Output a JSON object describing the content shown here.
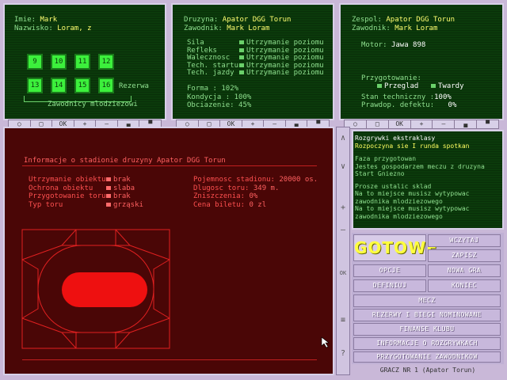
{
  "panel1": {
    "imie_label": "Imie:",
    "imie_value": "Mark",
    "nazwisko_label": "Nazwisko:",
    "nazwisko_value": "Loram, z",
    "squares_top": [
      "9",
      "10",
      "11",
      "12"
    ],
    "squares_bottom": [
      "13",
      "14",
      "15",
      "16"
    ],
    "rezerwa_label": "Rezerwa",
    "mlodziezowi_label": "Zawodnicy mlodziezowi"
  },
  "panel2": {
    "druzyna_label": "Druzyna:",
    "druzyna_value": "Apator DGG Torun",
    "zawodnik_label": "Zawodnik:",
    "zawodnik_value": "Mark Loram",
    "stats": [
      {
        "label": "Sila",
        "value": "Utrzymanie poziomu"
      },
      {
        "label": "Refleks",
        "value": "Utrzymanie poziomu"
      },
      {
        "label": "Walecznosc",
        "value": "Utrzymanie poziomu"
      },
      {
        "label": "Tech. startu",
        "value": "Utrzymanie poziomu"
      },
      {
        "label": "Tech. jazdy",
        "value": "Utrzymanie poziomu"
      }
    ],
    "forma_label": "Forma",
    "forma_value": ": 102%",
    "kondycja_label": "Kondycja",
    "kondycja_value": ": 100%",
    "obciazenie_label": "Obciazenie:",
    "obciazenie_value": "45%"
  },
  "panel3": {
    "zespol_label": "Zespol:",
    "zespol_value": "Apator DGG Torun",
    "zawodnik_label": "Zawodnik:",
    "zawodnik_value": "Mark Loram",
    "motor_label": "Motor:",
    "motor_value": "Jawa 898",
    "przygotowanie_label": "Przygotowanie:",
    "przeglad": "Przeglad",
    "twardy": "Twardy",
    "stan_label": "Stan techniczny :",
    "stan_value": "100%",
    "prawdop_label": "Prawdop. defektu:",
    "prawdop_value": "0%"
  },
  "toolbar_labels": [
    "○",
    "□",
    "OK",
    "+",
    "–",
    "▄",
    "▀"
  ],
  "stadium": {
    "title": "Informacje o stadionie druzyny Apator DGG Torun",
    "left_rows": [
      {
        "label": "Utrzymanie obiektu",
        "value": "brak"
      },
      {
        "label": "Ochrona obiektu",
        "value": "slaba"
      },
      {
        "label": "Przygotowanie toru",
        "value": "brak"
      },
      {
        "label": "Typ toru",
        "value": "grząski"
      }
    ],
    "right_rows": [
      {
        "label": "Pojemnosc stadionu:",
        "value": "20000 os."
      },
      {
        "label": "Dlugosc toru:",
        "value": "349 m."
      },
      {
        "label": "Zniszczenia:",
        "value": "0%"
      },
      {
        "label": "Cena biletu:",
        "value": "0 zl"
      }
    ]
  },
  "sidebar_icons": [
    "∧",
    "∨",
    "+",
    "–",
    "OK",
    "≡",
    "?"
  ],
  "messages": {
    "line1": "Rozgrywki ekstraklasy",
    "line2": "Rozpoczyna sie I runda spotkan",
    "line3": "Faza przygotowan",
    "line4": "Jestes gospodarzem meczu z druzyna",
    "line5": "Start Gniezno",
    "line6": "Prosze ustalic sklad",
    "line7": "Na to miejsce musisz wytypowac",
    "line8": "zawodnika mlodziezowego",
    "line9": "Na to miejsce musisz wytypowac",
    "line10": "zawodnika mlodziezowego"
  },
  "menu": {
    "gotowe": "GOTOWE",
    "wczytaj": "WCZYTAJ",
    "zapisz": "ZAPISZ",
    "opcje": "OPCJE",
    "nowa_gra": "NOWA GRA",
    "definiuj": "DEFINIUJ",
    "koniec": "KONIEC",
    "mecz": "MECZ",
    "rezerwy": "REZERWY I BIEGI NOMINOWANE",
    "finanse": "FINANSE KLUBU",
    "informacje": "INFORMACJE O ROZGRYWKACH",
    "przygotowanie": "PRZYGOTOWANIE ZAWODNIKOW"
  },
  "status": "GRACZ NR 1   (Apator Torun)"
}
